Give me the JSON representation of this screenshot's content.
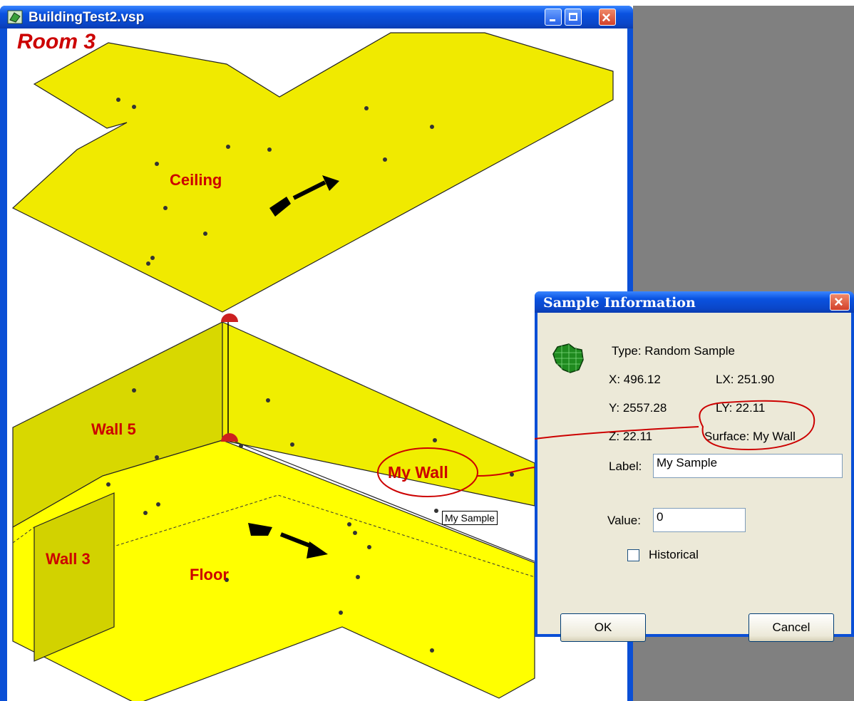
{
  "window": {
    "title": "BuildingTest2.vsp",
    "room_title": "Room 3"
  },
  "surfaces": {
    "ceiling": "Ceiling",
    "wall5": "Wall 5",
    "wall3": "Wall 3",
    "floor": "Floor"
  },
  "annotation": {
    "callout": "My Wall",
    "sample_tag": "My Sample"
  },
  "dialog": {
    "title": "Sample Information",
    "type": "Type: Random Sample",
    "x": "X: 496.12",
    "lx": "LX: 251.90",
    "y": "Y: 2557.28",
    "ly": "LY: 22.11",
    "z": "Z: 22.11",
    "surface": "Surface: My Wall",
    "label_caption": "Label:",
    "label_value": "My Sample",
    "value_caption": "Value:",
    "value_value": "0",
    "historical": "Historical",
    "ok": "OK",
    "cancel": "Cancel"
  },
  "colors": {
    "surface_fill": "#ffff00",
    "wall_fill": "#d8d800",
    "label_red": "#cc0000",
    "titlebar": "#0a52e0"
  },
  "icons": [
    "app-icon",
    "minimize-icon",
    "maximize-icon",
    "close-icon",
    "sample-icon",
    "north-arrow-icon"
  ]
}
